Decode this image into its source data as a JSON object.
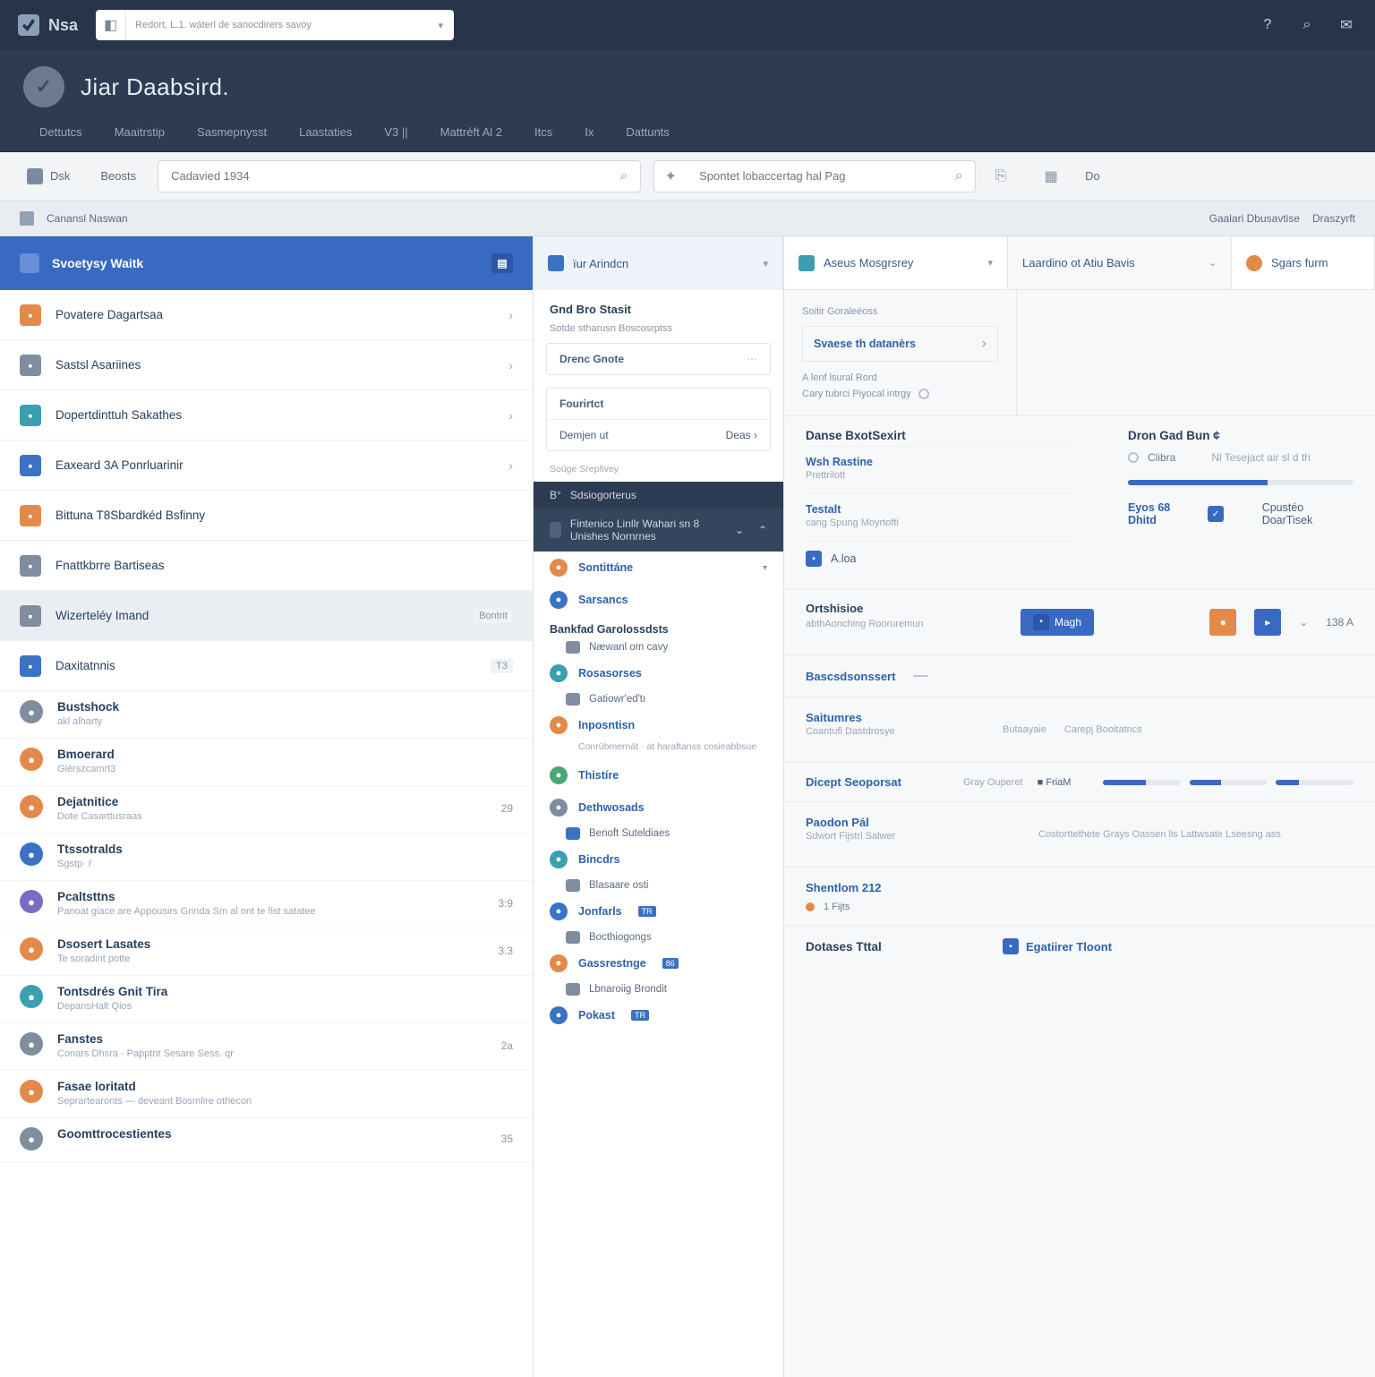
{
  "topbar": {
    "brand": "Nsa",
    "combo_text": "Redort, L.1. wáterl de sanocdirers savoy",
    "icon_help": "?",
    "icon_search": "⌕",
    "icon_msg": "✉"
  },
  "title": "Jiar Daabsird.",
  "topnav": [
    "Dettutcs",
    "Maaitrstip",
    "Sasmepnysst",
    "Laastaties",
    "V3 ||",
    "Mattréft Al 2",
    "Itcs",
    "Ix",
    "Dattunts"
  ],
  "toolbar": {
    "pill1": "Dsk",
    "pill2": "Beosts",
    "search1_ph": "Cadavied 1934",
    "search2_ph": "Spontet lobaccertag hal Pag",
    "right_tag": "Do"
  },
  "subbar": {
    "label": "Canansl Naswan",
    "link1": "Gaalari Dbusavtise",
    "link2": "Draszyrft"
  },
  "sidebar": {
    "head": "Svoetysy Waitk",
    "nav": [
      {
        "t": "Povatere Dagartsaa",
        "icn": "c-or",
        "chev": true
      },
      {
        "t": "Sastsl Asariines",
        "icn": "c-gr",
        "chev": true
      },
      {
        "t": "Dopertdinttuh Sakathes",
        "icn": "c-te",
        "chev": true
      },
      {
        "t": "Eaxeard 3A Ponrluarinir",
        "icn": "c-bl",
        "chev": true
      },
      {
        "t": "Bittuna T8Sbardkéd Bsfinny",
        "icn": "c-or",
        "chev": false
      },
      {
        "t": "Fnattkbrre Bartiseas",
        "icn": "c-gr",
        "chev": false
      },
      {
        "t": "Wizerteléy Imand",
        "icn": "c-gr",
        "sel": true,
        "badge": "Bontrit"
      },
      {
        "t": "Daxitatnnis",
        "icn": "c-bl",
        "badge": "T3"
      }
    ],
    "items": [
      {
        "t": "Bustshock",
        "s": "akl alharty",
        "c": "",
        "ic": "c-gr"
      },
      {
        "t": "Bmoerard",
        "s": "Glérszcamrt3",
        "c": "",
        "ic": "c-or"
      },
      {
        "t": "Dejatnitice",
        "s": "Dote Casarttusraas",
        "c": "29",
        "ic": "c-or"
      },
      {
        "t": "Ttssotralds",
        "s": "Sgstp· ř",
        "c": "",
        "ic": "c-bl"
      },
      {
        "t": "Pcaltsttns",
        "s": "Panoat giace are Appousirs Grinda Sm al ont te fist satatee",
        "c": "3:9",
        "ic": "c-pu"
      },
      {
        "t": "Dsosert Lasates",
        "s": "Te soradint potte",
        "c": "3.3",
        "ic": "c-or"
      },
      {
        "t": "Tontsdrés Gnit Tira",
        "s": "DepansHalt Qios",
        "c": "",
        "ic": "c-te"
      },
      {
        "t": "Fanstes",
        "s": "Conars Dhsra · Papptnt Sesare Sess. qr",
        "c": "2a",
        "ic": "c-gr"
      },
      {
        "t": "Fasae loritatd",
        "s": "Seprartearonts — deveant Bosmlire othecon",
        "c": "",
        "ic": "c-or"
      },
      {
        "t": "Goomttrocestientes",
        "s": "",
        "c": "35",
        "ic": "c-gr"
      }
    ]
  },
  "center": {
    "tab1": "ïur Arindcn",
    "subtabs_head": "Gnd Bro Stasit",
    "subtabs_sub": "Sotde stharusn Boscosrptss",
    "card1_k": "Drenc Gnote",
    "card2_h": "Fourirtct",
    "card2_k": "Demjen ut",
    "card2_v": "Deas  ›",
    "card2_sub": "Soúge Srepfivey",
    "dark1_pre": "B°",
    "dark1": "Sdsiogorterus",
    "dark2": "Fintenico Linllr Wahari sn 8 Unishes Nornrnes",
    "cats": [
      {
        "t": "Sontittáne",
        "ic": "c-or",
        "chev": true
      },
      {
        "t": "Sarsancs",
        "ic": "c-bl"
      },
      {
        "hd": "Bankfad Garolossdsts"
      },
      {
        "line": "Næwanl om cavy",
        "mic": "c-gr"
      },
      {
        "t": "Rosasorses",
        "ic": "c-te"
      },
      {
        "line": "Gatiowr'ed'tı",
        "mic": "c-gr"
      },
      {
        "t": "Inposntisn",
        "ic": "c-or"
      },
      {
        "sub": "Conrübmernät · at haraftanss cosieabbsue"
      },
      {
        "t": "Thistíre",
        "ic": "c-gn"
      },
      {
        "t": "Dethwosads",
        "ic": "c-gr"
      },
      {
        "line": "Benoft Suteldiaes",
        "mic": "c-bl"
      },
      {
        "t": "Bincdrs",
        "ic": "c-te"
      },
      {
        "line": "Blasaare osti",
        "mic": "c-gr"
      },
      {
        "t": "Jonfarls",
        "ic": "c-bl",
        "pill": "TR"
      },
      {
        "line": "Bocthiogongs",
        "mic": "c-gr"
      },
      {
        "t": "Gassrestnge",
        "ic": "c-or",
        "pill": "86"
      },
      {
        "line": "Lbnaroiig Brondit",
        "mic": "c-gr"
      },
      {
        "t": "Pokast",
        "ic": "c-bl",
        "pill": "TR"
      }
    ]
  },
  "right": {
    "tab2": "Aseus Mosgrsrey",
    "tab3": "Laardino ot Atiu Bavis",
    "tab4": "Sgars furm",
    "side_sub": "Soitir Goraleéoss",
    "side_card_k": "Svaese th datanèrs",
    "side_l1": "A lenf lsural Rord",
    "side_l2": "Cary tubrci Piyocal intrgy",
    "p1_h": "Danse BxotSexirt",
    "p1_k1": "Wsh Rastine",
    "p1_s1": "Prettrilott",
    "p1_k2": "Testalt",
    "p1_s2": "cang Spung Moyrtofti",
    "p1_k3": "A.loa",
    "p2_h": "Dron Gad Bun ¢",
    "p2_opt1": "Clibra",
    "p2_opt2": "Nl Tesejact air sl d th",
    "p2_lbl": "Eyos 68 Dhitd",
    "p2_chk": "Cpustéo DoarTisek",
    "p3_k": "Ortshisioe",
    "p3_s": "abthAonching Rooruremun",
    "p3_btn": "Magh",
    "p3_rt": "138 A",
    "p4_k": "Bascsdsonssert",
    "p5_k": "Saitumres",
    "p5_s": "Coantufi Dastdrosye",
    "p5_r1": "Butaayaie",
    "p5_r2": "Carepj Booitatncs",
    "p6_k": "Dicept Seoporsat",
    "p6_l": "Gray Ouperet",
    "p6_m": "FriaM",
    "p7_k": "Paodon Pál",
    "p7_s": "Sdwort Fijstrl Salwer",
    "p7_r": "Costorttethete Grays Oassen lis Lattwsate Lseesng ass",
    "p8_k": "Shentlom 212",
    "p8_s": "1 Fijts",
    "p9_k": "Dotases Tttal",
    "p9_r": "Egatiirer Tloont"
  }
}
